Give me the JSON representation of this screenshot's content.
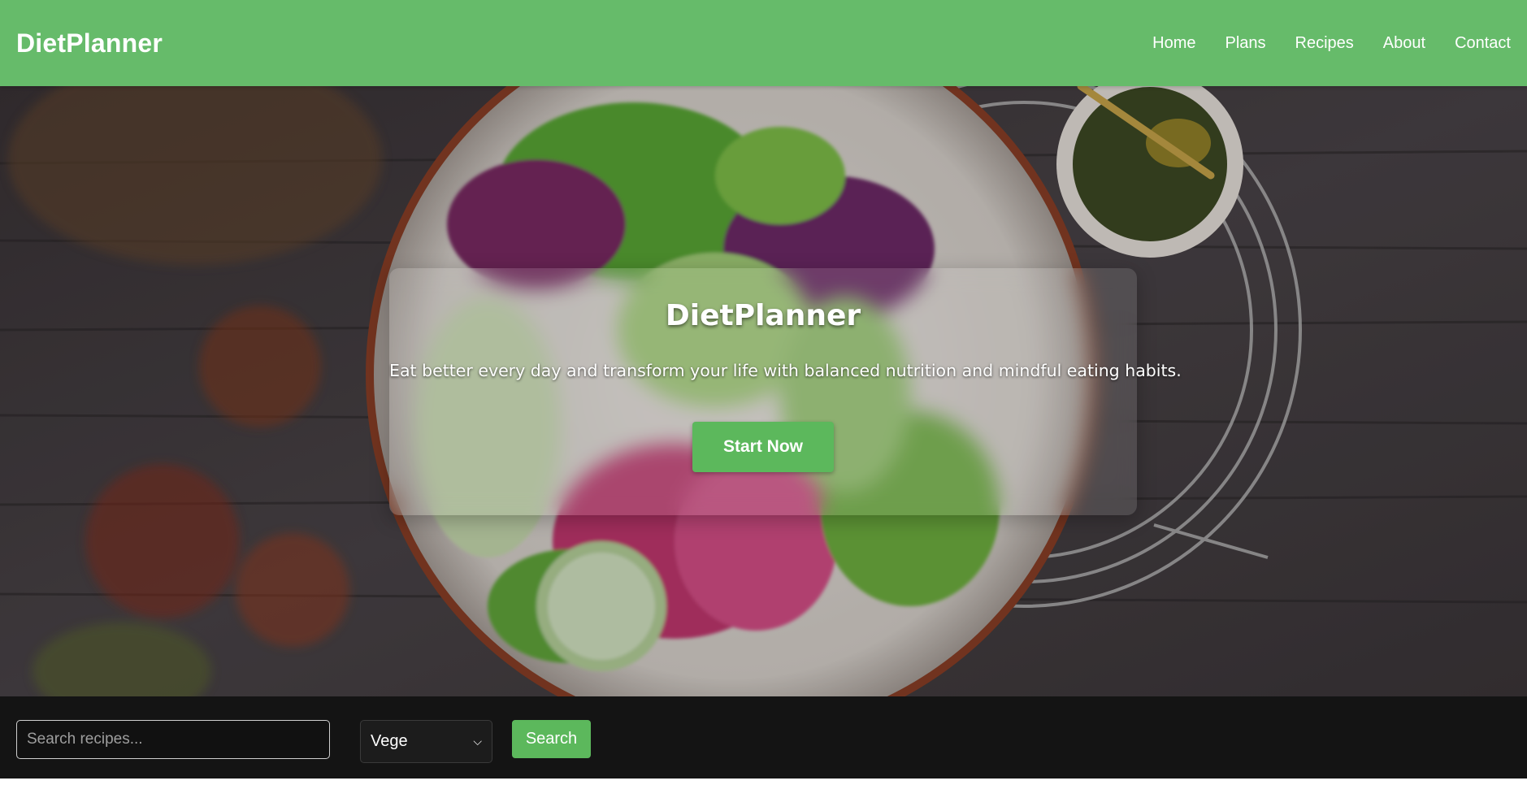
{
  "header": {
    "brand": "DietPlanner",
    "nav": [
      "Home",
      "Plans",
      "Recipes",
      "About",
      "Contact"
    ]
  },
  "hero": {
    "title": "DietPlanner",
    "subtitle": "Eat better every day and transform your life with balanced nutrition and mindful eating habits.",
    "cta_label": "Start Now"
  },
  "search": {
    "placeholder": "Search recipes...",
    "value": "",
    "selected_option": "Vege",
    "button_label": "Search"
  },
  "colors": {
    "header_bg": "#66bb6a",
    "accent_button": "#5cb85c",
    "searchbar_bg": "#141414"
  },
  "icons": {
    "select_arrow": "chevron-down-icon"
  }
}
